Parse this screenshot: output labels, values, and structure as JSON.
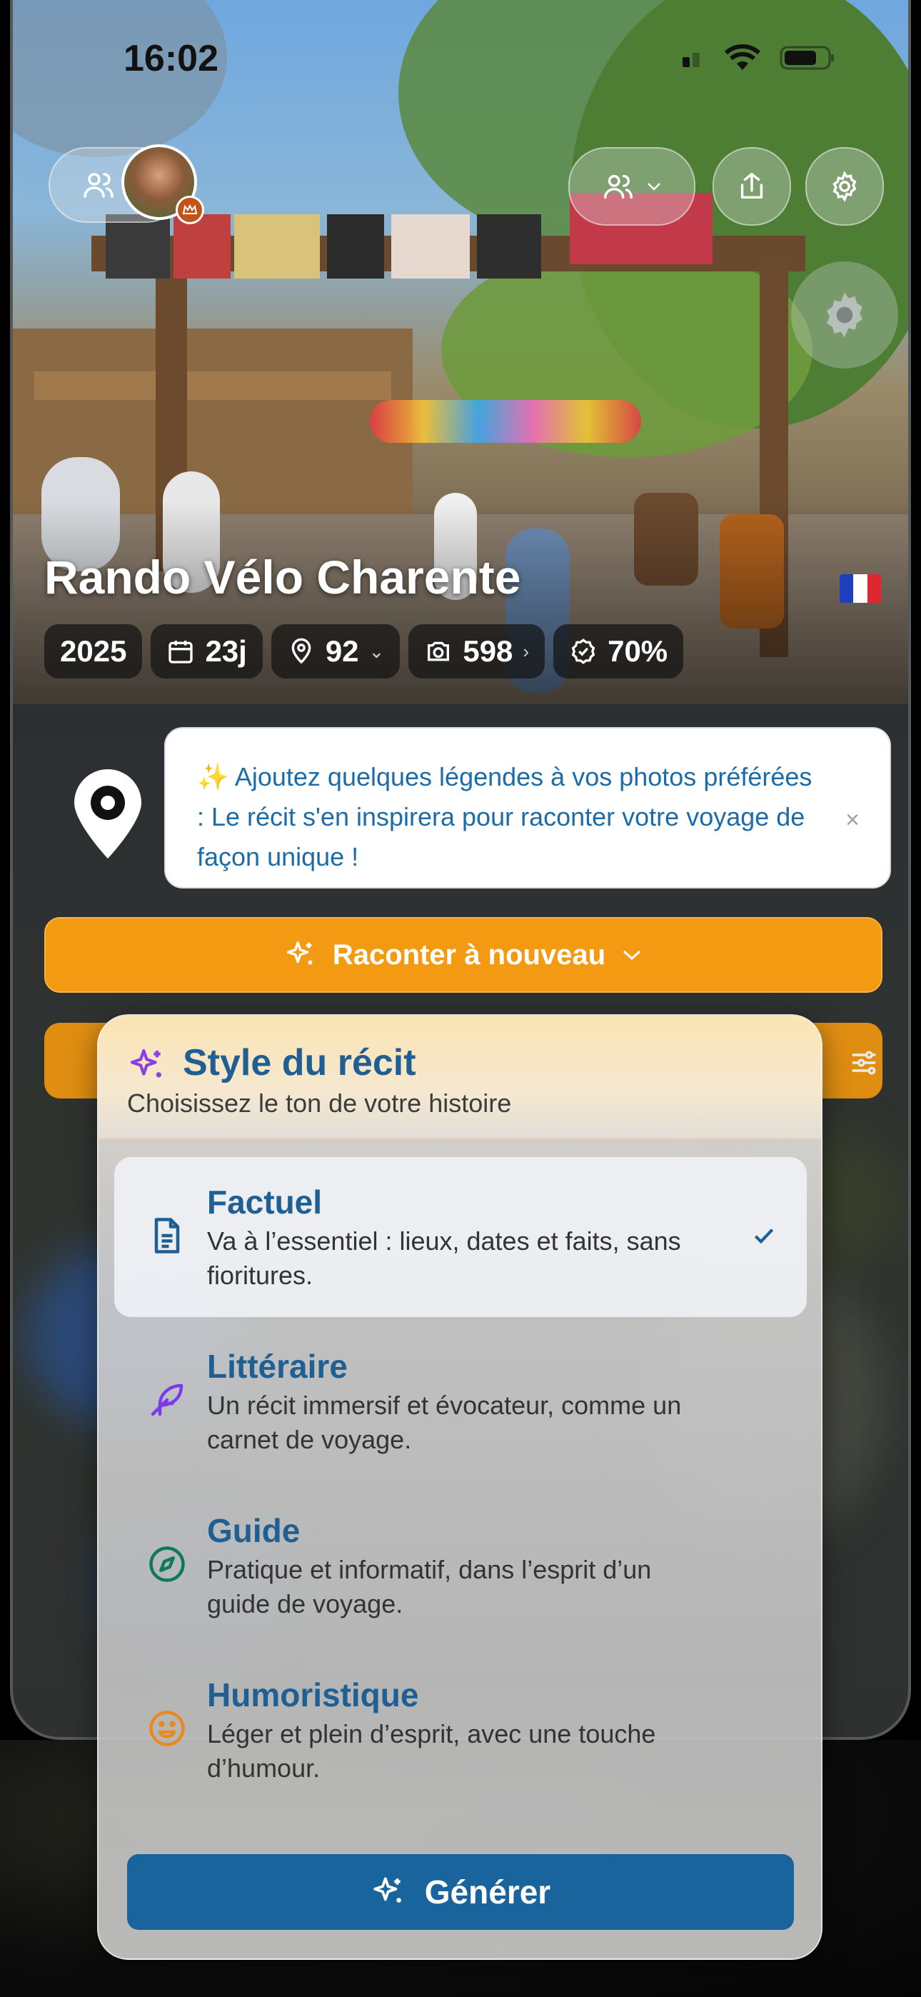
{
  "status_bar": {
    "time": "16:02"
  },
  "header": {
    "title": "Rando Vélo Charente",
    "flag": "France"
  },
  "stats": [
    {
      "label": "2025",
      "icon": "none"
    },
    {
      "label": "23j",
      "icon": "calendar-icon"
    },
    {
      "label": "92",
      "icon": "map-pin-icon",
      "chevron": "⌄"
    },
    {
      "label": "598",
      "icon": "camera-icon",
      "chevron": "›"
    },
    {
      "label": "70%",
      "icon": "badge-check-icon"
    }
  ],
  "tip": {
    "text": "✨ Ajoutez quelques légendes à vos photos préférées : Le récit s'en inspirera pour raconter votre voyage de façon unique !",
    "close": "×"
  },
  "cta": {
    "label": "Raconter à nouveau"
  },
  "sheet": {
    "title": "Style du récit",
    "subtitle": "Choisissez le ton de votre histoire",
    "options": [
      {
        "title": "Factuel",
        "desc": "Va à l’essentiel : lieux, dates et faits, sans fioritures.",
        "icon": "document-icon",
        "color": "#1f5f94",
        "selected": true
      },
      {
        "title": "Littéraire",
        "desc": "Un récit immersif et évocateur, comme un carnet de voyage.",
        "icon": "feather-icon",
        "color": "#7c3aed",
        "selected": false
      },
      {
        "title": "Guide",
        "desc": "Pratique et informatif, dans l’esprit d’un guide de voyage.",
        "icon": "compass-icon",
        "color": "#0f7a55",
        "selected": false
      },
      {
        "title": "Humoristique",
        "desc": "Léger et plein d’esprit, avec une touche d’humour.",
        "icon": "smile-icon",
        "color": "#e98a1f",
        "selected": false
      }
    ],
    "generate_label": "Générer"
  },
  "colors": {
    "accent": "#f39a12",
    "primary": "#1a649e",
    "title_blue": "#1f5f94"
  }
}
